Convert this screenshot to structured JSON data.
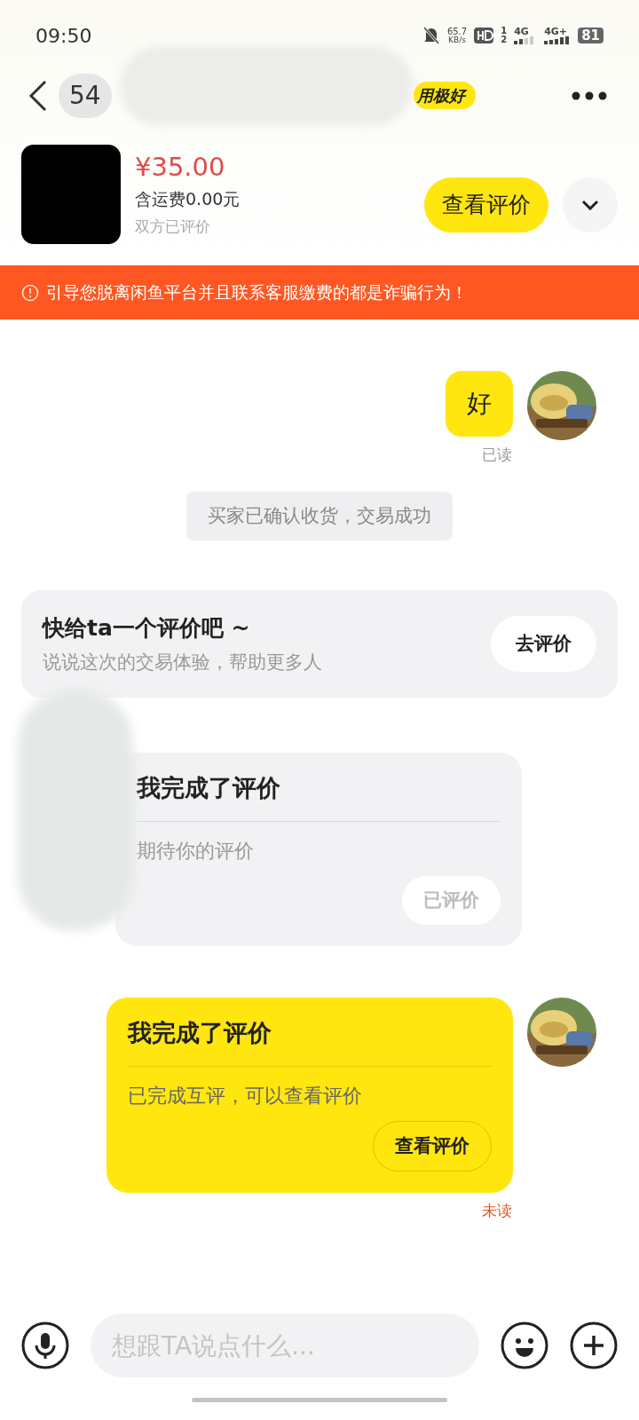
{
  "status_bar": {
    "time": "09:50",
    "net_speed": "65.7",
    "net_unit": "KB/s",
    "sim_labels": [
      "1",
      "2"
    ],
    "net_1": "4G",
    "net_2": "4G+",
    "battery": "81"
  },
  "header": {
    "unread_count": "54",
    "badge": "用极好"
  },
  "product": {
    "price": "¥35.00",
    "shipping": "含运费0.00元",
    "status": "双方已评价",
    "button": "查看评价"
  },
  "warning": "引导您脱离闲鱼平台并且联系客服缴费的都是诈骗行为！",
  "messages": [
    {
      "kind": "text",
      "text": "好",
      "receipt": "已读",
      "receipt_unread": false
    },
    {
      "kind": "system",
      "text": "买家已确认收货，交易成功"
    },
    {
      "kind": "prompt",
      "title": "快给ta一个评价吧 ~",
      "subtitle": "说说这次的交易体验，帮助更多人",
      "button": "去评价"
    },
    {
      "kind": "card",
      "mine": false,
      "title": "我完成了评价",
      "body": "期待你的评价",
      "button": "已评价",
      "button_disabled": true
    },
    {
      "kind": "card",
      "mine": true,
      "title": "我完成了评价",
      "body": "已完成互评，可以查看评价",
      "button": "查看评价",
      "button_disabled": false,
      "receipt": "未读",
      "receipt_unread": true
    }
  ],
  "input": {
    "placeholder": "想跟TA说点什么..."
  }
}
